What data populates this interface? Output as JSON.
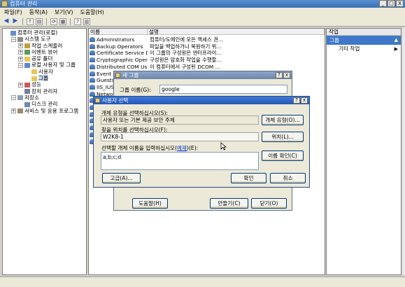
{
  "window": {
    "title": "컴퓨터 관리",
    "buttons": [
      "_",
      "□",
      "X"
    ]
  },
  "menu": [
    "파일(F)",
    "동작(A)",
    "보기(V)",
    "도움말(H)"
  ],
  "tree": [
    {
      "label": "컴퓨터 관리(로컬)",
      "level": 0,
      "exp": "",
      "icon": "computer-icon"
    },
    {
      "label": "시스템 도구",
      "level": 1,
      "exp": "−",
      "icon": "tools-icon"
    },
    {
      "label": "작업 스케줄러",
      "level": 2,
      "exp": "+",
      "icon": "clock-icon"
    },
    {
      "label": "이벤트 뷰어",
      "level": 2,
      "exp": "+",
      "icon": "event-icon"
    },
    {
      "label": "공유 폴더",
      "level": 2,
      "exp": "+",
      "icon": "folder-icon"
    },
    {
      "label": "로컬 사용자 및 그룹",
      "level": 2,
      "exp": "−",
      "icon": "users-icon"
    },
    {
      "label": "사용자",
      "level": 3,
      "exp": "",
      "icon": "folder-icon"
    },
    {
      "label": "그룹",
      "level": 3,
      "exp": "",
      "icon": "folder-icon",
      "selected": true
    },
    {
      "label": "성능",
      "level": 2,
      "exp": "+",
      "icon": "performance-icon"
    },
    {
      "label": "장치 관리자",
      "level": 2,
      "exp": "",
      "icon": "device-icon"
    },
    {
      "label": "저장소",
      "level": 1,
      "exp": "−",
      "icon": "storage-icon"
    },
    {
      "label": "디스크 관리",
      "level": 2,
      "exp": "",
      "icon": "disk-icon"
    },
    {
      "label": "서비스 및 응용 프로그램",
      "level": 1,
      "exp": "+",
      "icon": "services-icon"
    }
  ],
  "list": {
    "columns": [
      "이름",
      "설명"
    ],
    "rows": [
      {
        "name": "Administrators",
        "desc": "컴퓨터/도메인에 모든 엑세스 권..."
      },
      {
        "name": "Backup Operators",
        "desc": "파일을 백업하거나 복원하기 위..."
      },
      {
        "name": "Certificate Service D...",
        "desc": "이 그룹의 구성원은 엔터프라이..."
      },
      {
        "name": "Cryptographic Oper...",
        "desc": "구성원은 암호화 작업을 수행할..."
      },
      {
        "name": "Distributed COM Us...",
        "desc": "이 컴퓨터에서 구성된 DCOM ..."
      },
      {
        "name": "Event L",
        "desc": ""
      },
      {
        "name": "Guests",
        "desc": ""
      },
      {
        "name": "IIS_IUSR",
        "desc": ""
      },
      {
        "name": "Network",
        "desc": ""
      },
      {
        "name": "",
        "desc": ""
      },
      {
        "name": "",
        "desc": ""
      },
      {
        "name": "",
        "desc": ""
      },
      {
        "name": "",
        "desc": ""
      },
      {
        "name": "",
        "desc": ""
      },
      {
        "name": "",
        "desc": ""
      },
      {
        "name": "",
        "desc": ""
      }
    ]
  },
  "actions": {
    "header": "작업",
    "section": "그룹",
    "item": "기타 작업"
  },
  "group_dialog": {
    "title": "새 그룹",
    "name_label": "그룹 이름(G):",
    "name_value": "google",
    "help": "도움말(H)",
    "create": "만들기(C)",
    "close": "닫기(O)"
  },
  "select_dialog": {
    "title": "사용자 선택",
    "type_label": "개체 유형을 선택하십시오(S):",
    "type_value": "사용자 또는 기본 제공 보안 주체",
    "type_button": "개체 유형(O)...",
    "loc_label": "찾을 위치를 선택하십시오(F):",
    "loc_value": "W2K8-1",
    "loc_button": "위치(L)...",
    "names_label_pre": "선택할 개체 이름을 입력하십시오(",
    "names_label_link": "예제",
    "names_label_post": ")(E):",
    "names_value": "a;b;c;d",
    "check_button": "이름 확인(C)",
    "advanced": "고급(A)...",
    "ok": "확인",
    "cancel": "취소"
  }
}
